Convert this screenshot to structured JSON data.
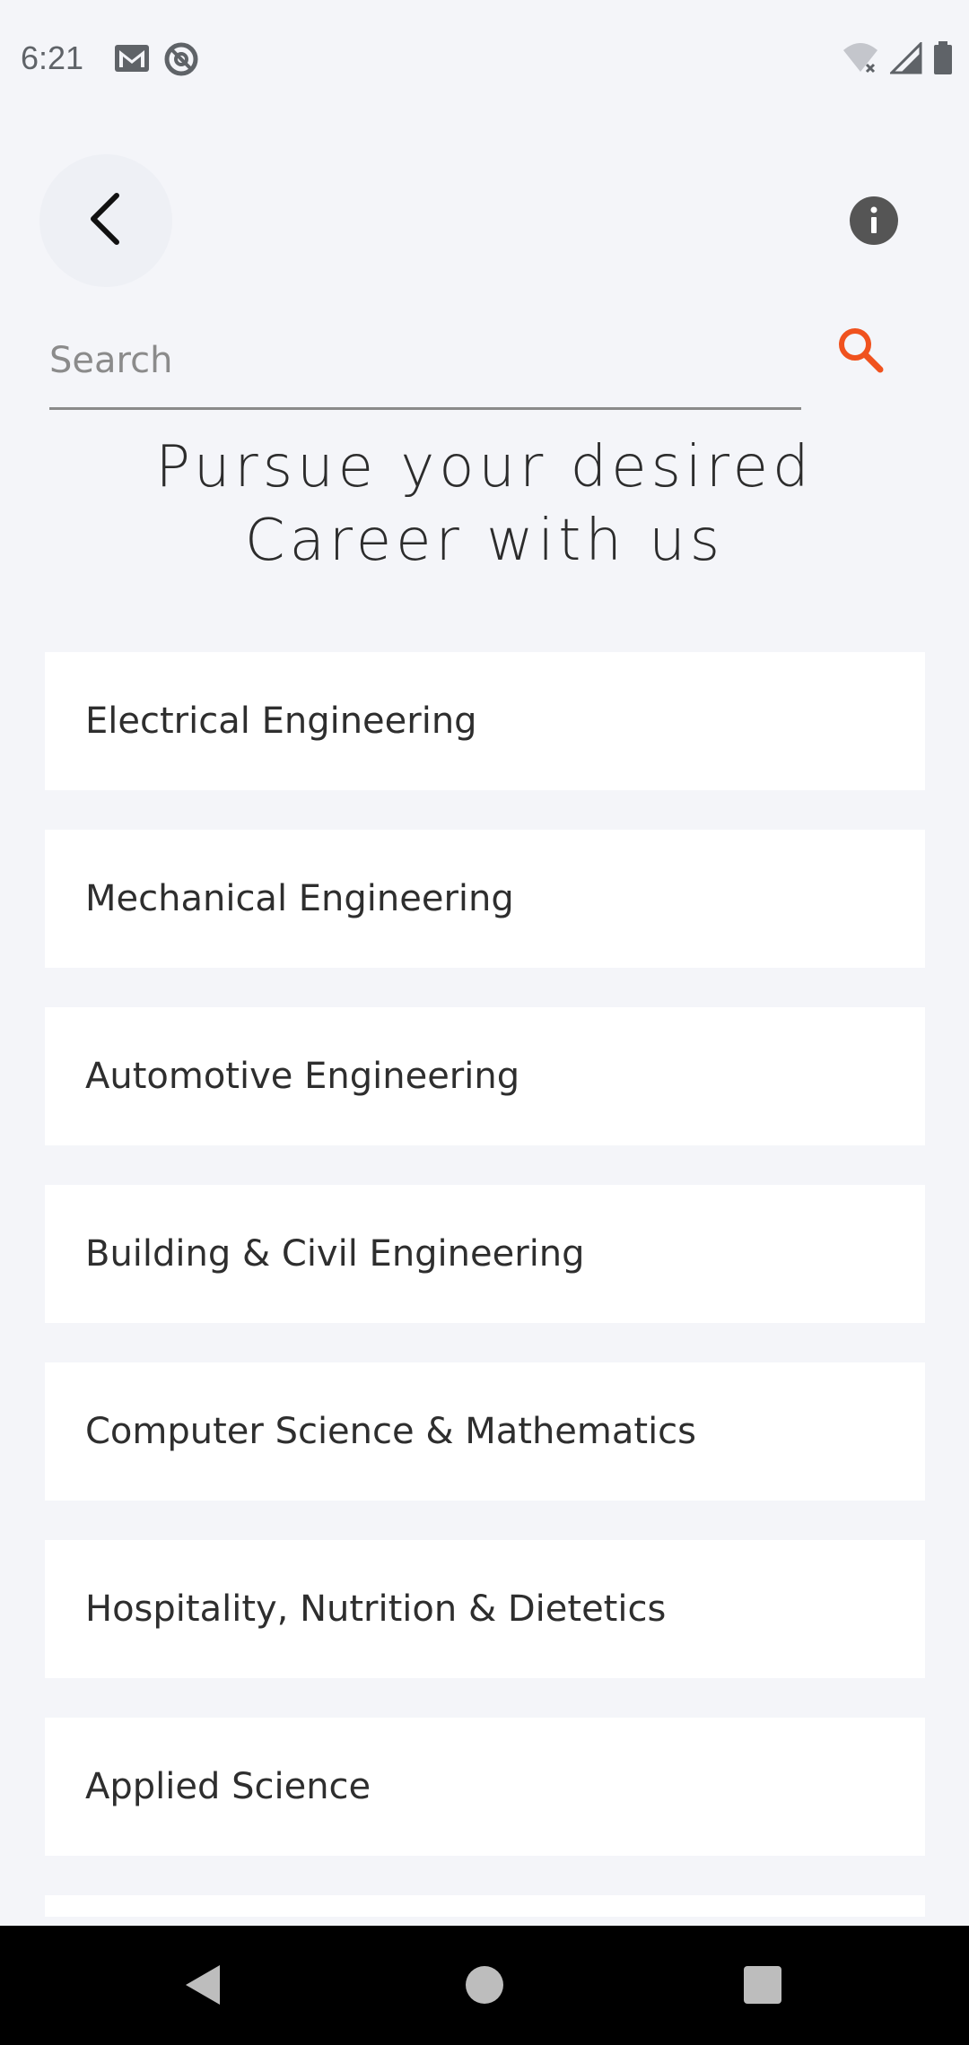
{
  "status_bar": {
    "time": "6:21",
    "notification_icons": [
      "gmail-icon",
      "at-sign-icon"
    ],
    "system_icons": [
      "wifi-off-icon",
      "signal-icon",
      "battery-icon"
    ]
  },
  "header": {
    "back_icon": "chevron-left-icon",
    "info_icon": "info-icon"
  },
  "search": {
    "placeholder": "Search",
    "value": "",
    "icon": "search-icon",
    "icon_color": "#f0521e"
  },
  "title": "Pursue your desired Career with us",
  "careers": [
    {
      "label": "Electrical Engineering"
    },
    {
      "label": "Mechanical Engineering"
    },
    {
      "label": "Automotive Engineering"
    },
    {
      "label": "Building & Civil Engineering"
    },
    {
      "label": "Computer Science & Mathematics"
    },
    {
      "label": "Hospitality, Nutrition & Dietetics"
    },
    {
      "label": "Applied Science"
    },
    {
      "label": ""
    }
  ],
  "nav_bar": {
    "icons": [
      "nav-back-icon",
      "nav-home-icon",
      "nav-recents-icon"
    ]
  },
  "colors": {
    "accent": "#f0521e",
    "background": "#f4f5f9",
    "card": "#ffffff"
  }
}
